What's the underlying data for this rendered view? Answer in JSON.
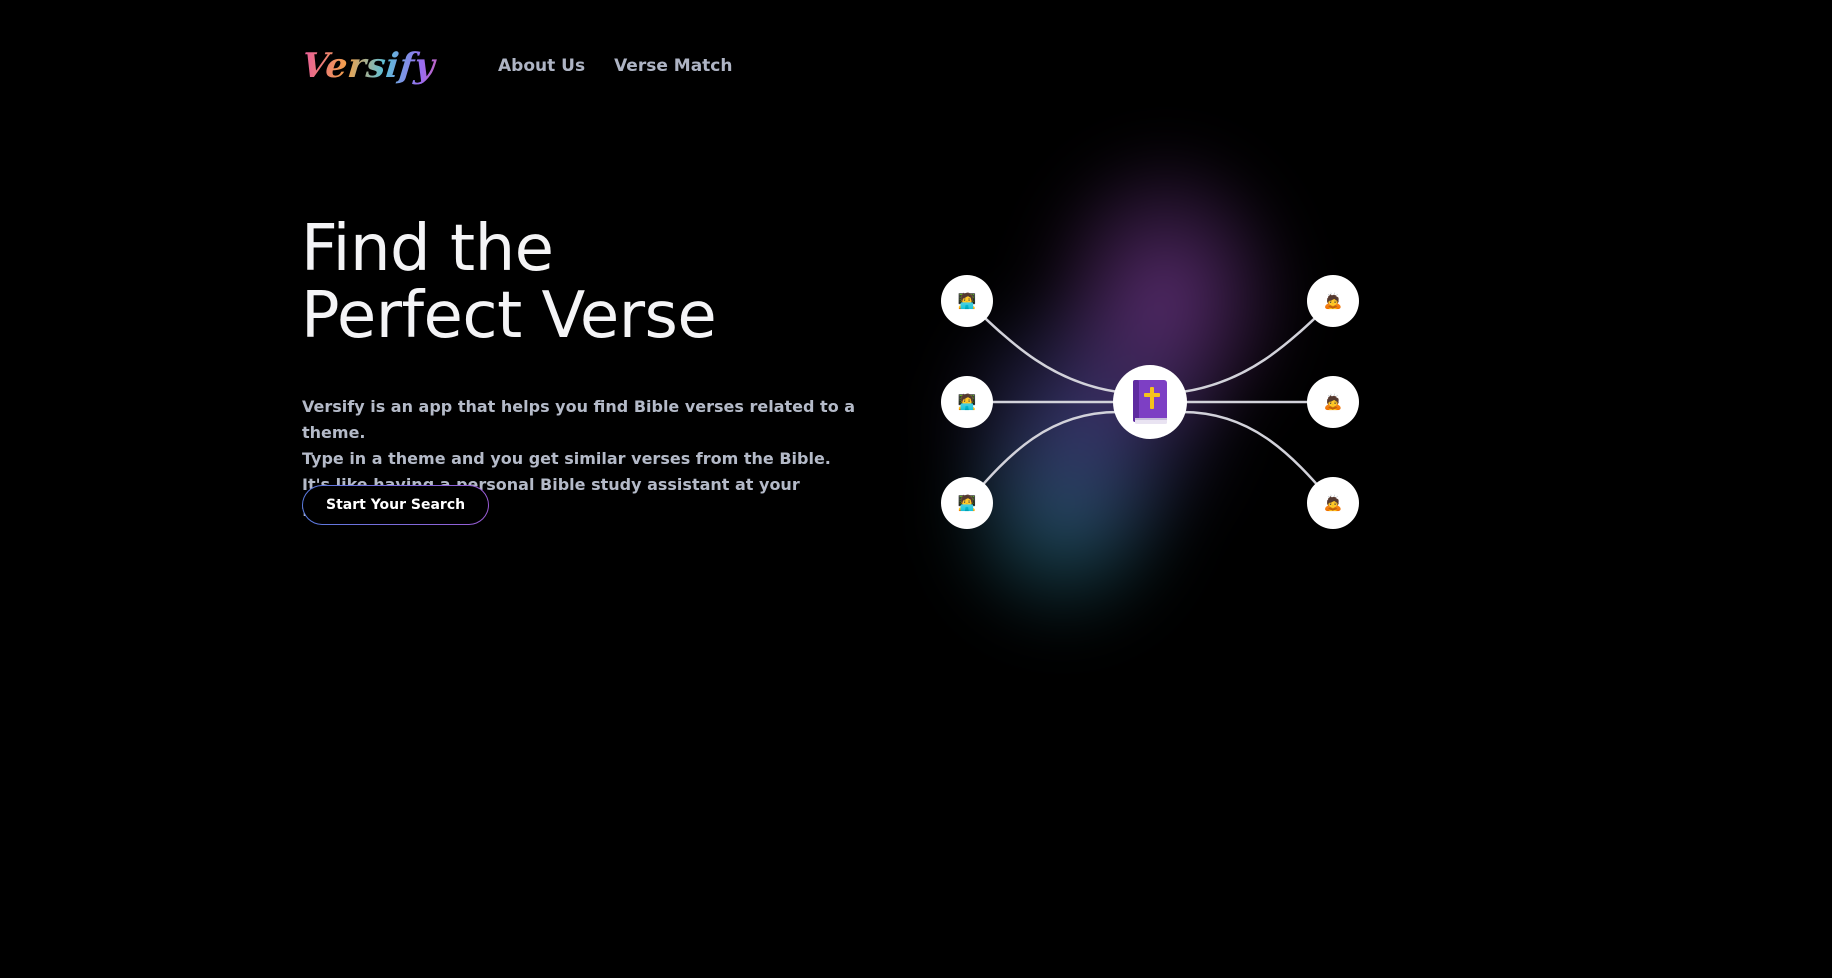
{
  "brand": {
    "logo_text": "Versify"
  },
  "nav": {
    "links": [
      "About Us",
      "Verse Match"
    ]
  },
  "hero": {
    "title_line1": "Find the",
    "title_line2": "Perfect Verse",
    "description": [
      "Versify is an app that helps you find Bible verses related to a theme.",
      "Type in a theme and you get similar verses from the Bible.",
      "It's like having a personal Bible study assistant at your fingertips."
    ],
    "cta_label": "Start Your Search"
  },
  "diagram": {
    "center_icon": "bible-book-icon",
    "left_nodes_icon": "person-at-computer-icon",
    "right_nodes_icon": "praying-person-icon"
  },
  "colors": {
    "background": "#000000",
    "title": "#f4f4f6",
    "body_text": "#b4bac8",
    "book_purple": "#7d3fc4",
    "cross_gold": "#f5c21b"
  }
}
